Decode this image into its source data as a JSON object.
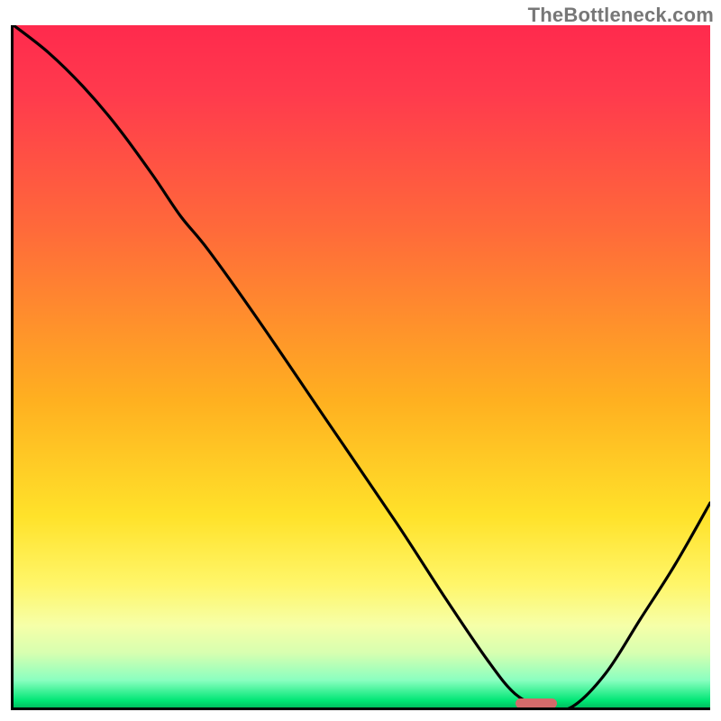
{
  "watermark": "TheBottleneck.com",
  "colors": {
    "gradient_top": "#ff2a4d",
    "gradient_mid": "#ffe22a",
    "gradient_bottom": "#00c060",
    "curve": "#000000",
    "marker": "#d46a6a",
    "axis": "#000000"
  },
  "chart_data": {
    "type": "line",
    "title": "",
    "xlabel": "",
    "ylabel": "",
    "xlim": [
      0,
      100
    ],
    "ylim": [
      0,
      100
    ],
    "x": [
      0,
      5,
      10,
      15,
      20,
      24,
      28,
      35,
      45,
      55,
      62,
      68,
      72,
      76,
      80,
      85,
      90,
      95,
      100
    ],
    "y": [
      100,
      96,
      91,
      85,
      78,
      72,
      67,
      57,
      42,
      27,
      16,
      7,
      2,
      0,
      0,
      5,
      13,
      21,
      30
    ],
    "marker": {
      "x": 75,
      "y": 0.6,
      "w": 6,
      "h": 1.4
    },
    "note": "x and y are percentages of the plot area; values estimated from pixels"
  }
}
